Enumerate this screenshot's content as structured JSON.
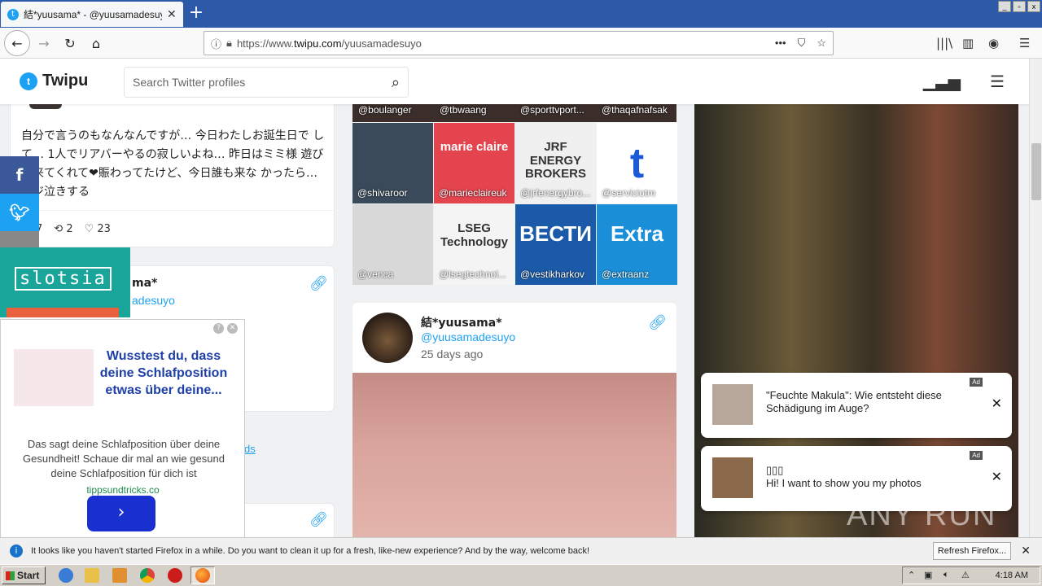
{
  "browser": {
    "tab_title": "結*yuusama* - @yuusamadesuyo",
    "tab_close": "✕",
    "new_tab": "+",
    "url_prefix": "https://www.",
    "url_host": "twipu.com",
    "url_path": "/yuusamadesuyo",
    "url_menu": "•••"
  },
  "site": {
    "logo_text": "Twipu",
    "search_placeholder": "Search Twitter profiles"
  },
  "tweet": {
    "text": "自分で言うのもなんなんですが… 今日わたしお誕生日で して… 1人でリアバーやるの寂しいよね… 昨日はミミ様 遊びに来てくれて❤賑わってたけど、今日誰も来な かったら… マジ泣きする",
    "likes_left": "7",
    "retweets": "2",
    "likes": "23"
  },
  "profile_card2": {
    "name_fragment": "ma*",
    "handle_fragment": "adesuyo"
  },
  "follow_link_fragment": "ds",
  "grid_top": [
    "@boulanger",
    "@tbwaang",
    "@sporttvport...",
    "@thaqafnafsak"
  ],
  "grid": [
    {
      "handle": "@shivaroor",
      "bg": "#3a4a5a"
    },
    {
      "handle": "@marieclaireuk",
      "bg": "#e3444e",
      "label": "marie claire"
    },
    {
      "handle": "@jrfenergybro...",
      "bg": "#f0f0f0",
      "label": "JRF ENERGY BROKERS"
    },
    {
      "handle": "@serviciotm",
      "bg": "#ffffff",
      "label": "t"
    },
    {
      "handle": "@venca",
      "bg": "#d8d8d8"
    },
    {
      "handle": "@lsegtechnol...",
      "bg": "#f4f4f4",
      "label": "LSEG Technology"
    },
    {
      "handle": "@vestikharkov",
      "bg": "#1a5aa8",
      "label": "ВЕСТИ"
    },
    {
      "handle": "@extraanz",
      "bg": "#1a8fd8",
      "label": "Extra"
    }
  ],
  "post": {
    "name": "結*yuusama*",
    "handle": "@yuusamadesuyo",
    "date": "25 days ago"
  },
  "ads": {
    "slots_text": "slotsia",
    "ad2_headline": "Wusstest du, dass deine Schlafposition etwas über deine...",
    "ad2_body": "Das sagt deine Schlafposition über deine Gesundheit! Schaue dir mal an wie gesund deine Schlafposition für dich ist",
    "ad2_source": "tippsundtricks.co",
    "ad2_button": "›",
    "notif1_text": "\"Feuchte Makula\": Wie entsteht diese Schädigung im Auge?",
    "notif2_title": "▯▯▯",
    "notif2_text": "Hi! I want to show you my photos",
    "ad_tag": "Ad",
    "close": "✕"
  },
  "ffbar": {
    "message": "It looks like you haven't started Firefox in a while. Do you want to clean it up for a fresh, like-new experience? And by the way, welcome back!",
    "refresh_button": "Refresh Firefox...",
    "close": "✕"
  },
  "taskbar": {
    "start": "Start",
    "clock": "4:18 AM"
  },
  "watermark": "ANY RUN"
}
